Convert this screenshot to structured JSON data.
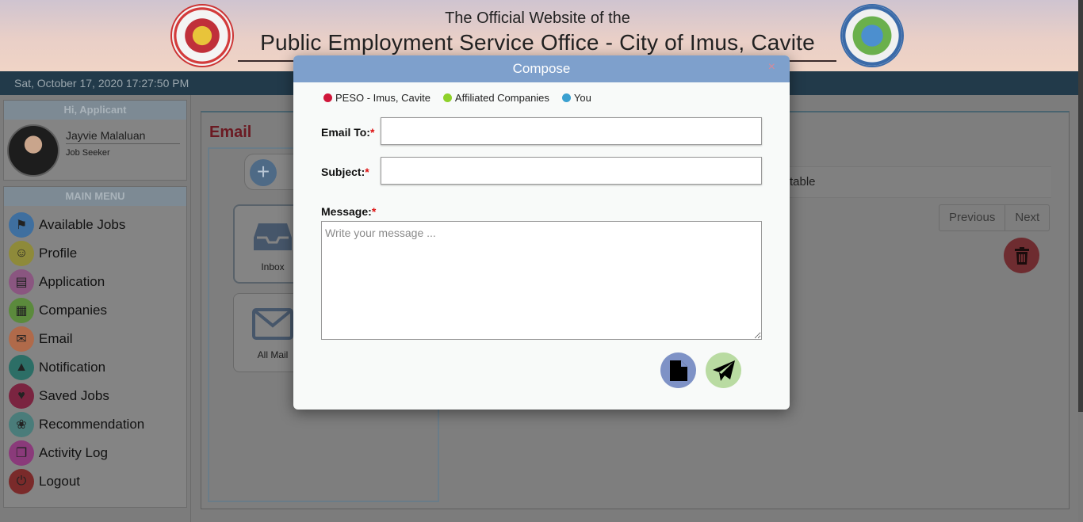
{
  "header": {
    "line1": "The Official Website of the",
    "line2": "Public Employment Service Office - City of Imus, Cavite",
    "datetime": "Sat, October 17, 2020 17:27:50 PM"
  },
  "sidebar": {
    "greeting": "Hi, Applicant",
    "user_name": "Jayvie Malaluan",
    "user_role": "Job Seeker",
    "menu_title": "MAIN MENU",
    "items": [
      {
        "label": "Available Jobs",
        "icon": "bookmark-icon",
        "color": "#3f6f9f"
      },
      {
        "label": "Profile",
        "icon": "user-icon",
        "color": "#8e8a3a"
      },
      {
        "label": "Application",
        "icon": "folder-icon",
        "color": "#8a5680"
      },
      {
        "label": "Companies",
        "icon": "building-icon",
        "color": "#5b8a3c"
      },
      {
        "label": "Email",
        "icon": "envelope-icon",
        "color": "#b06a4a"
      },
      {
        "label": "Notification",
        "icon": "bell-icon",
        "color": "#2c6e66"
      },
      {
        "label": "Saved Jobs",
        "icon": "heart-icon",
        "color": "#7a2440"
      },
      {
        "label": "Recommendation",
        "icon": "award-icon",
        "color": "#4a7c7a"
      },
      {
        "label": "Activity Log",
        "icon": "copy-icon",
        "color": "#8a3a7a"
      },
      {
        "label": "Logout",
        "icon": "power-icon",
        "color": "#7a2a2a"
      }
    ]
  },
  "main": {
    "title": "Email",
    "folders": [
      {
        "label": "Inbox",
        "icon": "inbox-icon"
      },
      {
        "label": "All Mail",
        "icon": "envelope-icon"
      }
    ],
    "table_text": "table",
    "pager": {
      "previous": "Previous",
      "next": "Next"
    }
  },
  "modal": {
    "title": "Compose",
    "close": "×",
    "legend": [
      {
        "label": "PESO - Imus, Cavite",
        "color": "#d0163a"
      },
      {
        "label": "Affiliated Companies",
        "color": "#8ed12a"
      },
      {
        "label": "You",
        "color": "#3aa0d0"
      }
    ],
    "to_label": "Email To:",
    "subject_label": "Subject:",
    "message_label": "Message:",
    "required_mark": "*",
    "to_value": "",
    "subject_value": "",
    "message_placeholder": "Write your message ...",
    "colors": {
      "header": "#7ea0cc",
      "file_button": "#7e92c6",
      "send_button": "#b9dba2"
    }
  }
}
